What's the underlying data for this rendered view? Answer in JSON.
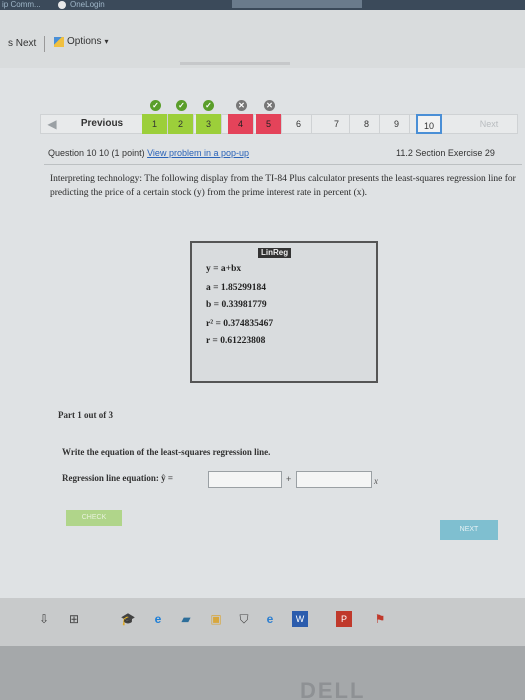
{
  "browser": {
    "tab1": "ip Comm...",
    "tab2": "OneLogin",
    "toolbar_next": "s  Next",
    "toolbar_options": "Options"
  },
  "nav": {
    "previous_label": "Previous",
    "next_label": "Next",
    "questions": [
      {
        "num": "1",
        "status": "correct"
      },
      {
        "num": "2",
        "status": "correct"
      },
      {
        "num": "3",
        "status": "correct"
      },
      {
        "num": "4",
        "status": "incorrect"
      },
      {
        "num": "5",
        "status": "incorrect"
      },
      {
        "num": "6",
        "status": "none"
      },
      {
        "num": "7",
        "status": "none"
      },
      {
        "num": "8",
        "status": "none"
      },
      {
        "num": "9",
        "status": "none"
      },
      {
        "num": "10",
        "status": "current"
      }
    ]
  },
  "question": {
    "header_prefix": "Question 10 ",
    "header_of": "10 (1 point)",
    "popup_link": "View problem in a pop-up",
    "section": "11.2 Section Exercise 29",
    "text": "Interpreting technology: The following display from the TI-84 Plus calculator presents the least-squares regression line for predicting the price of a certain stock (y) from the prime interest rate in percent (x)."
  },
  "calculator": {
    "title": "LinReg",
    "lines": [
      "y = a+bx",
      "a = 1.85299184",
      "b = 0.33981779",
      "r² = 0.374835467",
      "r = 0.61223808"
    ]
  },
  "part": {
    "label": "Part 1 out of 3",
    "instruction": "Write the equation of the least-squares regression line.",
    "regression_label": "Regression line equation: ŷ =",
    "plus": "+",
    "x_var": "x",
    "input1_value": "",
    "input2_value": ""
  },
  "buttons": {
    "check": "CHECK",
    "next": "NEXT"
  },
  "brand": "DELL"
}
